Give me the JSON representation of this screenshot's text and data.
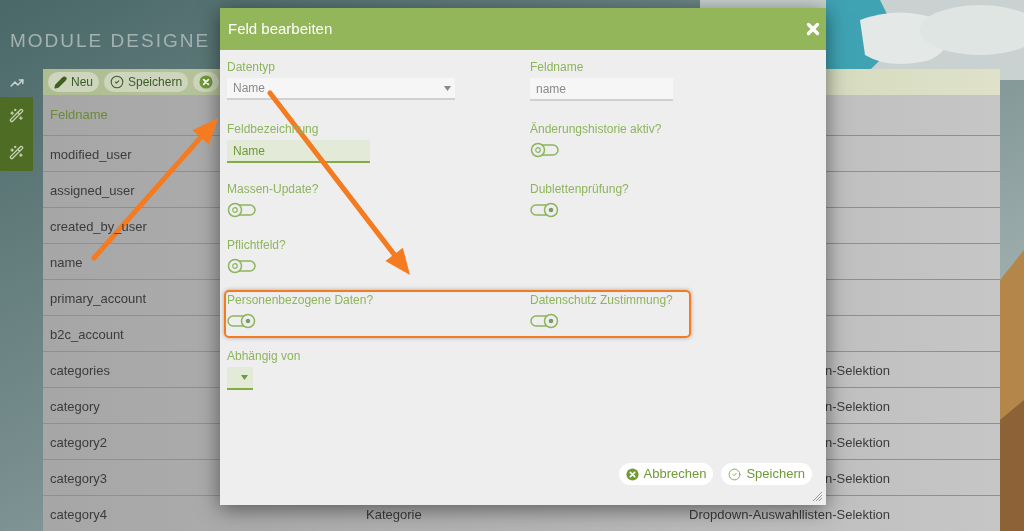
{
  "page": {
    "title": "MODULE DESIGNE"
  },
  "sidebar": {
    "items": [
      {
        "kind": "chart"
      },
      {
        "kind": "wand"
      },
      {
        "kind": "wand"
      }
    ]
  },
  "toolbar": {
    "buttons": [
      {
        "kind": "new",
        "label": "Neu"
      },
      {
        "kind": "save",
        "label": "Speichern"
      },
      {
        "kind": "cancel"
      }
    ]
  },
  "table": {
    "columns": [
      "Feldname"
    ],
    "rows": [
      {
        "column_1": "modified_user"
      },
      {
        "column_1": "assigned_user"
      },
      {
        "column_1": "created_by_user"
      },
      {
        "column_1": "name"
      },
      {
        "column_1": "primary_account"
      },
      {
        "column_1": "b2c_account"
      },
      {
        "column_1": "categories",
        "column_3": "n-Selektion"
      },
      {
        "column_1": "category",
        "column_3": "n-Selektion"
      },
      {
        "column_1": "category2",
        "column_3": "n-Selektion"
      },
      {
        "column_1": "category3",
        "column_3": "n-Selektion"
      },
      {
        "column_1": "category4",
        "column_2": "Kategorie",
        "column_3": "Dropdown-Auswahllisten-Selektion"
      }
    ]
  },
  "dialog": {
    "title": "Feld bearbeiten",
    "rows": [
      {
        "highlighted": false,
        "fields": [
          {
            "kind": "select",
            "label": "Datentyp",
            "value": "Name"
          },
          {
            "kind": "input",
            "label": "Feldname",
            "value": "name",
            "focused": false
          }
        ]
      },
      {
        "highlighted": false,
        "fields": [
          {
            "kind": "input",
            "label": "Feldbezeichnung",
            "value": "Name",
            "focused": true
          },
          {
            "kind": "toggle",
            "label": "Änderungshistorie aktiv?",
            "on": false
          }
        ]
      },
      {
        "highlighted": false,
        "fields": [
          {
            "kind": "toggle",
            "label": "Massen-Update?",
            "on": false
          },
          {
            "kind": "toggle",
            "label": "Dublettenprüfung?",
            "on": true
          }
        ]
      },
      {
        "highlighted": false,
        "fields": [
          {
            "kind": "toggle",
            "label": "Pflichtfeld?",
            "on": false
          }
        ]
      },
      {
        "highlighted": true,
        "fields": [
          {
            "kind": "toggle",
            "label": "Personenbezogene Daten?",
            "on": true
          },
          {
            "kind": "toggle",
            "label": "Datenschutz Zustimmung?",
            "on": true
          }
        ]
      },
      {
        "highlighted": false,
        "fields": [
          {
            "kind": "mini-select",
            "label": "Abhängig von"
          }
        ]
      }
    ],
    "buttons": [
      {
        "kind": "cancel",
        "label": "Abbrechen"
      },
      {
        "kind": "save",
        "label": "Speichern"
      }
    ]
  }
}
